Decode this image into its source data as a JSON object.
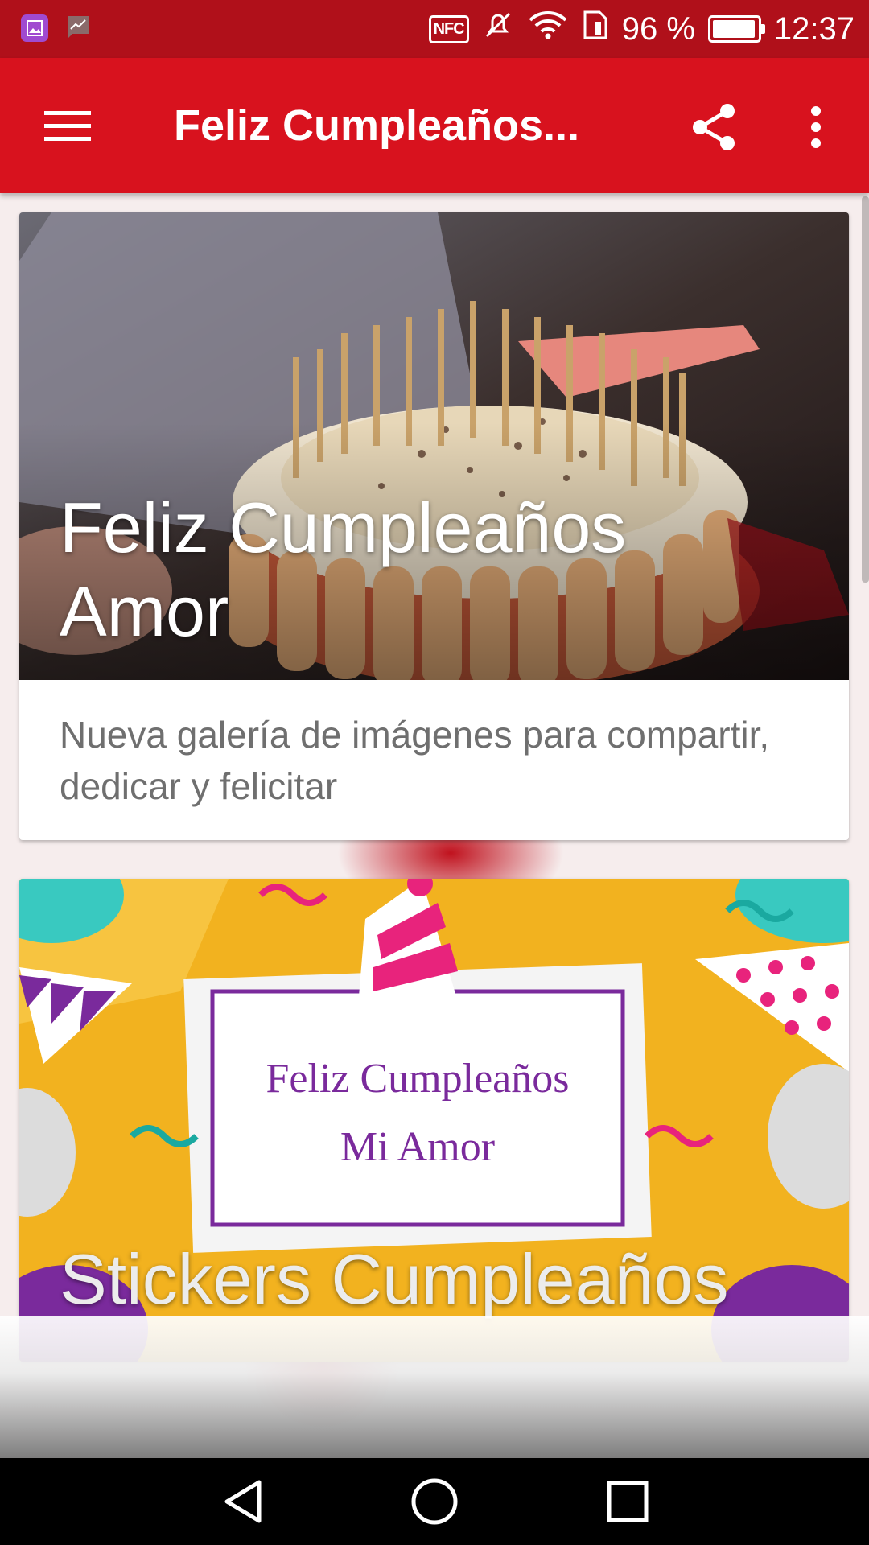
{
  "status_bar": {
    "nfc_label": "NFC",
    "battery_text": "96 %",
    "battery_level": 0.96,
    "time": "12:37",
    "icons": [
      "gallery-notification-icon",
      "chart-notification-icon",
      "nfc-icon",
      "silent-icon",
      "wifi-icon",
      "sim-icon",
      "battery-icon"
    ]
  },
  "app_bar": {
    "title": "Feliz Cumpleaños...",
    "icons": [
      "hamburger-menu-icon",
      "share-icon",
      "more-vert-icon"
    ]
  },
  "cards": [
    {
      "title": "Feliz Cumpleaños Amor",
      "subtitle": "Nueva galería de imágenes para compartir, dedicar y felicitar"
    },
    {
      "title": "Stickers Cumpleaños",
      "image_text_line1": "Feliz Cumpleaños",
      "image_text_line2": "Mi Amor"
    }
  ],
  "nav_bar": {
    "icons": [
      "back-icon",
      "home-icon",
      "recents-icon"
    ]
  },
  "colors": {
    "status_bar": "#b0101a",
    "app_bar": "#d8121e",
    "nav_bar": "#000000"
  }
}
